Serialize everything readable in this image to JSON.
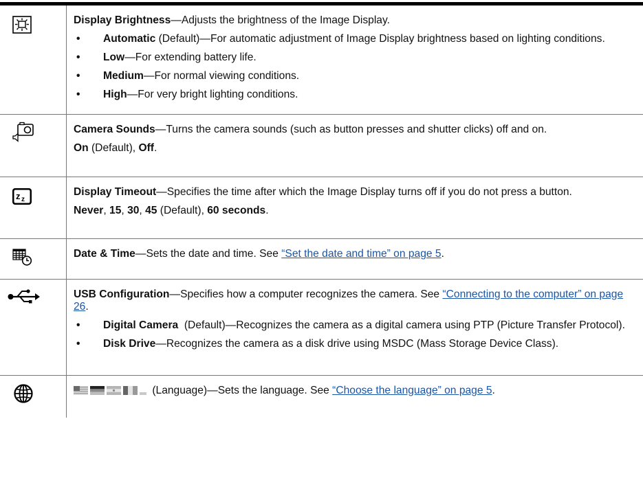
{
  "rows": [
    {
      "icon": "display-brightness-icon",
      "title": "Display Brightness",
      "desc": "—Adjusts the brightness of the Image Display.",
      "bullets": [
        {
          "term": "Automatic",
          "text": " (Default)—For automatic adjustment of Image Display brightness based on lighting conditions."
        },
        {
          "term": "Low",
          "text": "—For extending battery life."
        },
        {
          "term": "Medium",
          "text": "—For normal viewing conditions."
        },
        {
          "term": "High",
          "text": "—For very bright lighting conditions."
        }
      ]
    },
    {
      "icon": "camera-sounds-icon",
      "title": "Camera Sounds",
      "desc": "—Turns the camera sounds (such as button presses and shutter clicks) off and on.",
      "opt1": "On",
      "opt1_rest": " (Default), ",
      "opt2": "Off",
      "opt2_rest": "."
    },
    {
      "icon": "display-timeout-icon",
      "title": "Display Timeout",
      "desc": "—Specifies the time after which the Image Display turns off if you do not press a button.",
      "options": [
        {
          "bold": "Never",
          "plain": ", "
        },
        {
          "bold": "15",
          "plain": ", "
        },
        {
          "bold": "30",
          "plain": ", "
        },
        {
          "bold": "45",
          "plain": " (Default), "
        },
        {
          "bold": "60 seconds",
          "plain": "."
        }
      ]
    },
    {
      "icon": "date-time-icon",
      "title": "Date & Time",
      "desc": "—Sets the date and time. See ",
      "link": "“Set the date and time” on page 5",
      "after": "."
    },
    {
      "icon": "usb-icon",
      "title": "USB Configuration",
      "desc": "—Specifies how a computer recognizes the camera. See ",
      "link": "“Connecting to the computer” on page 26",
      "after": ".",
      "bullets": [
        {
          "term": "Digital Camera",
          "text": "  (Default)—Recognizes the camera as a digital camera using PTP (Picture Transfer Protocol)."
        },
        {
          "term": "Disk Drive",
          "text": "—Recognizes the camera as a disk drive using MSDC (Mass Storage Device Class)."
        }
      ]
    },
    {
      "icon": "language-globe-icon",
      "flags_icon": "language-flags-icon",
      "desc": " (Language)—Sets the language. See ",
      "link": "“Choose the language” on page 5",
      "after": "."
    }
  ],
  "colors": {
    "link": "#1a55a8",
    "rule": "#000000",
    "grid": "#777777"
  }
}
